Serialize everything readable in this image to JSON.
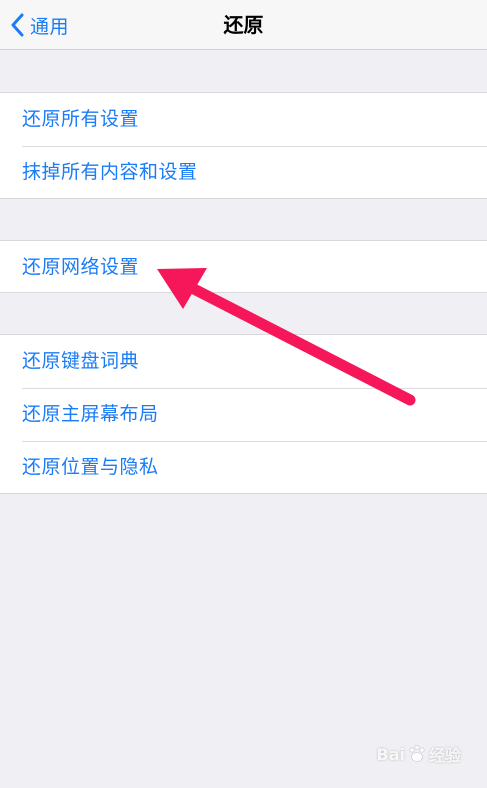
{
  "navbar": {
    "back_label": "通用",
    "title": "还原"
  },
  "groups": [
    {
      "items": [
        {
          "label": "还原所有设置"
        },
        {
          "label": "抹掉所有内容和设置"
        }
      ]
    },
    {
      "items": [
        {
          "label": "还原网络设置"
        }
      ]
    },
    {
      "items": [
        {
          "label": "还原键盘词典"
        },
        {
          "label": "还原主屏幕布局"
        },
        {
          "label": "还原位置与隐私"
        }
      ]
    }
  ],
  "watermark": {
    "brand_left": "Bai",
    "brand_right": "经验"
  },
  "colors": {
    "accent": "#1a7cf6",
    "background": "#efeff4",
    "annotation_arrow": "#f5175a"
  },
  "icons": {
    "back": "chevron-left-icon",
    "watermark": "baidu-paw-icon"
  }
}
